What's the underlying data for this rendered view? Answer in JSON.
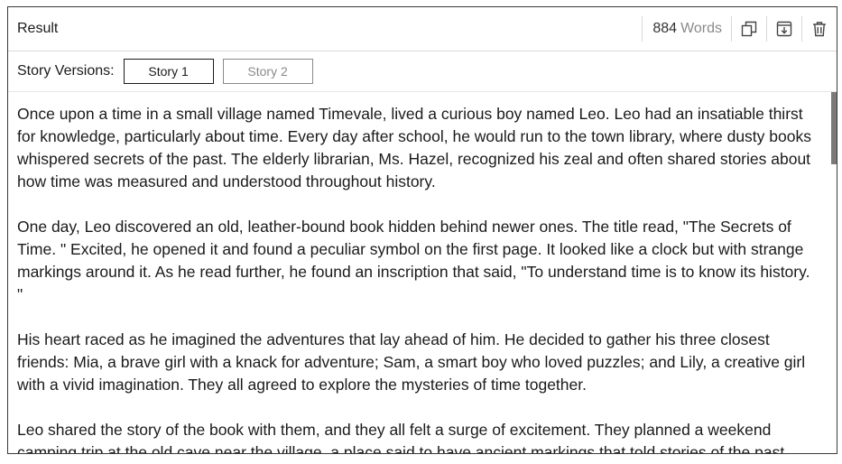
{
  "header": {
    "title": "Result",
    "word_count": "884",
    "word_unit": "Words",
    "icons": [
      "copy-icon",
      "download-icon",
      "trash-icon"
    ]
  },
  "versions": {
    "label": "Story Versions:",
    "items": [
      {
        "label": "Story 1",
        "active": true
      },
      {
        "label": "Story 2",
        "active": false
      }
    ]
  },
  "story": {
    "paragraphs": [
      "Once upon a time in a small village named Timevale, lived a curious boy named Leo. Leo had an insatiable thirst for knowledge, particularly about time. Every day after school, he would run to the town library, where dusty books whispered secrets of the past. The elderly librarian, Ms. Hazel, recognized his zeal and often shared stories about how time was measured and understood throughout history.",
      "One day, Leo discovered an old, leather-bound book hidden behind newer ones. The title read, \"The Secrets of Time. \" Excited, he opened it and found a peculiar symbol on the first page. It looked like a clock but with strange markings around it. As he read further, he found an inscription that said, \"To understand time is to know its history. \"",
      "His heart raced as he imagined the adventures that lay ahead of him. He decided to gather his three closest friends: Mia, a brave girl with a knack for adventure; Sam, a smart boy who loved puzzles; and Lily, a creative girl with a vivid imagination. They all agreed to explore the mysteries of time together.",
      "Leo shared the story of the book with them, and they all felt a surge of excitement. They planned a weekend camping trip at the old cave near the village, a place said to have ancient markings that told stories of the past."
    ]
  }
}
